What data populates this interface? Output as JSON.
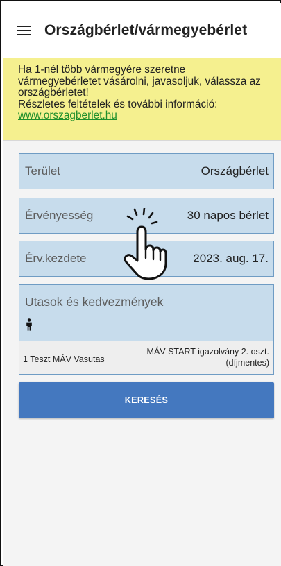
{
  "app_bar": {
    "title": "Országbérlet/vármegyebérlet",
    "menu_icon": "hamburger-menu-icon"
  },
  "notice": {
    "text": "Ha 1-nél több vármegyére szeretne vármegyebérletet vásárolni, javasoljuk, válassza az országbérletet!",
    "details_text": "Részletes feltételek és további információ:",
    "link": "www.orszagberlet.hu",
    "background_color": "#f5f08f"
  },
  "form": {
    "fields": [
      {
        "label": "Terület",
        "value": "Országbérlet"
      },
      {
        "label": "Érvényesség",
        "value": "30 napos bérlet"
      },
      {
        "label": "Érv.kezdete",
        "value": "2023. aug. 17."
      }
    ],
    "passengers": {
      "title": "Utasok és kedvezmények",
      "icon": "person-icon",
      "entry_name": "1 Teszt MÁV Vasutas",
      "entry_discount_line1": "MÁV-START igazolvány 2. oszt.",
      "entry_discount_line2": "(díjmentes)"
    },
    "search_button": "KERESÉS",
    "field_color": "#c7dcec",
    "button_color": "#4478bf"
  },
  "overlay": {
    "icon": "tap-hand-pointer-icon"
  }
}
